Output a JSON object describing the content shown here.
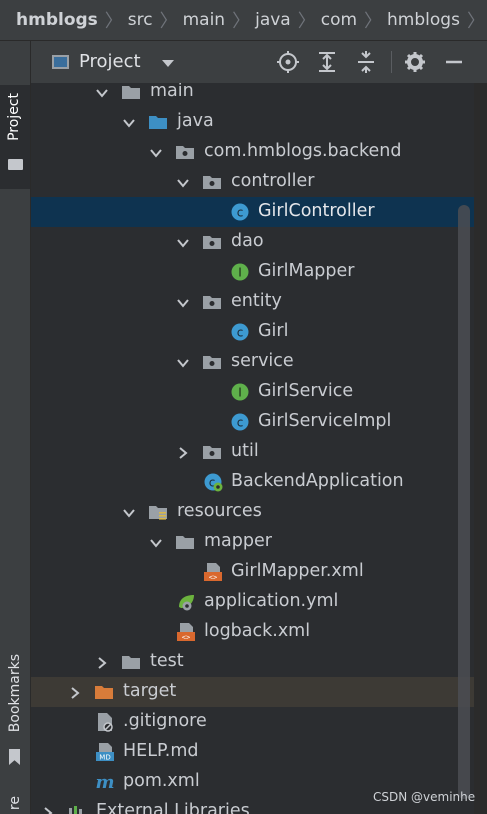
{
  "breadcrumbs": [
    "hmblogs",
    "src",
    "main",
    "java",
    "com",
    "hmblogs",
    "backe"
  ],
  "side_tabs": {
    "project": "Project",
    "bookmarks": "Bookmarks",
    "structure": "re"
  },
  "panel": {
    "title": "Project"
  },
  "tree": {
    "main": "main",
    "java": "java",
    "package": "com.hmblogs.backend",
    "controller": "controller",
    "girl_controller": "GirlController",
    "dao": "dao",
    "girl_mapper": "GirlMapper",
    "entity": "entity",
    "girl": "Girl",
    "service": "service",
    "girl_service": "GirlService",
    "girl_service_impl": "GirlServiceImpl",
    "util": "util",
    "backend_application": "BackendApplication",
    "resources": "resources",
    "mapper": "mapper",
    "girl_mapper_xml": "GirlMapper.xml",
    "application_yml": "application.yml",
    "logback_xml": "logback.xml",
    "test": "test",
    "target": "target",
    "gitignore": ".gitignore",
    "help_md": "HELP.md",
    "pom_xml": "pom.xml",
    "external_libraries": "External Libraries"
  },
  "colors": {
    "selected_row": "#0e3350",
    "excluded_row": "#3d3a35",
    "class_icon": "#3d9ad1",
    "interface_icon": "#5fb04b",
    "target_folder": "#d87c3a"
  },
  "watermark": "CSDN @veminhe"
}
